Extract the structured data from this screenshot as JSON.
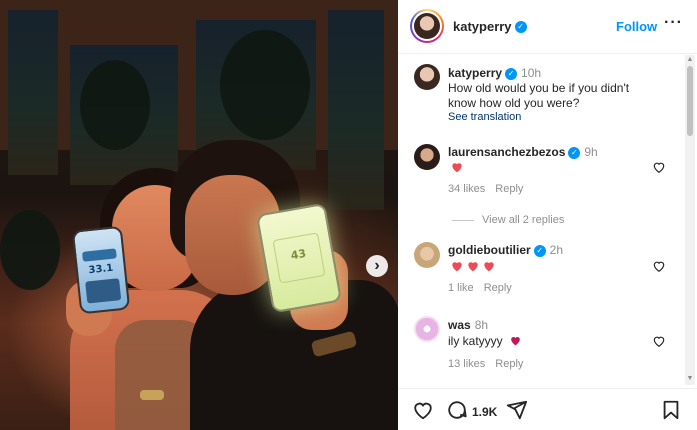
{
  "post": {
    "photo_alt_phone_a_value": "33.1",
    "photo_alt_phone_b_value": "43"
  },
  "header": {
    "username": "katyperry",
    "follow_label": "Follow",
    "more_icon": "more-horizontal-icon"
  },
  "caption": {
    "username": "katyperry",
    "time": "10h",
    "text": "How old would you be if you didn't know how old you were?",
    "see_translation": "See translation"
  },
  "comments": [
    {
      "username": "laurensanchezbezos",
      "time": "9h",
      "text_icons": "heart x1",
      "likes": "34 likes",
      "reply": "Reply",
      "view_replies": "View all 2 replies"
    },
    {
      "username": "goldieboutilier",
      "time": "2h",
      "text_icons": "heart x3",
      "likes": "1 like",
      "reply": "Reply"
    },
    {
      "username": "was",
      "time": "8h",
      "text": "ily katyyyy",
      "likes": "13 likes",
      "reply": "Reply"
    }
  ],
  "actions": {
    "comment_count": "1.9K"
  },
  "colors": {
    "accent": "#0095f6",
    "heart": "#ed4956",
    "verified": "#0095f6"
  }
}
